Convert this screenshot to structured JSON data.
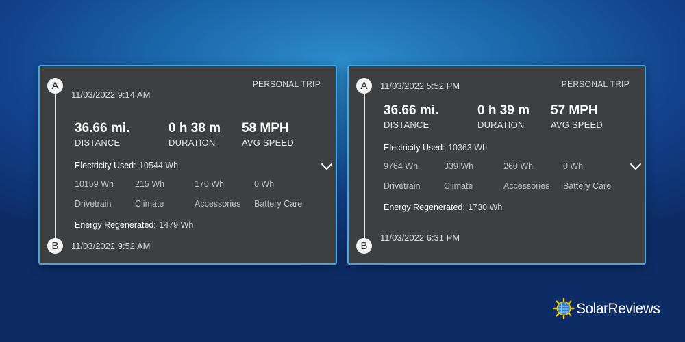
{
  "icons": {
    "expand": "chevron-down-icon",
    "logo": "sun-icon"
  },
  "colors": {
    "card_border": "#3fa9e6",
    "card_bg": "#3d3f40"
  },
  "trips": [
    {
      "trip_type": "PERSONAL TRIP",
      "start_label": "A",
      "end_label": "B",
      "start_time": "11/03/2022 9:14 AM",
      "end_time": "11/03/2022 9:52 AM",
      "distance": {
        "value": "36.66 mi.",
        "label": "DISTANCE"
      },
      "duration": {
        "value": "0 h 38 m",
        "label": "DURATION"
      },
      "avg_speed": {
        "value": "58 MPH",
        "label": "AVG SPEED"
      },
      "electricity_used": {
        "label": "Electricity Used:",
        "value": "10544 Wh"
      },
      "breakdown": [
        {
          "value": "10159 Wh",
          "label": "Drivetrain"
        },
        {
          "value": "215 Wh",
          "label": "Climate"
        },
        {
          "value": "170 Wh",
          "label": "Accessories"
        },
        {
          "value": "0 Wh",
          "label": "Battery Care"
        }
      ],
      "energy_regenerated": {
        "label": "Energy Regenerated:",
        "value": "1479 Wh"
      }
    },
    {
      "trip_type": "PERSONAL TRIP",
      "start_label": "A",
      "end_label": "B",
      "start_time": "11/03/2022 5:52 PM",
      "end_time": "11/03/2022 6:31 PM",
      "distance": {
        "value": "36.66 mi.",
        "label": "DISTANCE"
      },
      "duration": {
        "value": "0 h 39 m",
        "label": "DURATION"
      },
      "avg_speed": {
        "value": "57 MPH",
        "label": "AVG SPEED"
      },
      "electricity_used": {
        "label": "Electricity Used:",
        "value": "10363 Wh"
      },
      "breakdown": [
        {
          "value": "9764 Wh",
          "label": "Drivetrain"
        },
        {
          "value": "339 Wh",
          "label": "Climate"
        },
        {
          "value": "260 Wh",
          "label": "Accessories"
        },
        {
          "value": "0 Wh",
          "label": "Battery Care"
        }
      ],
      "energy_regenerated": {
        "label": "Energy Regenerated:",
        "value": "1730 Wh"
      }
    }
  ],
  "logo": {
    "text": "SolarReviews"
  }
}
